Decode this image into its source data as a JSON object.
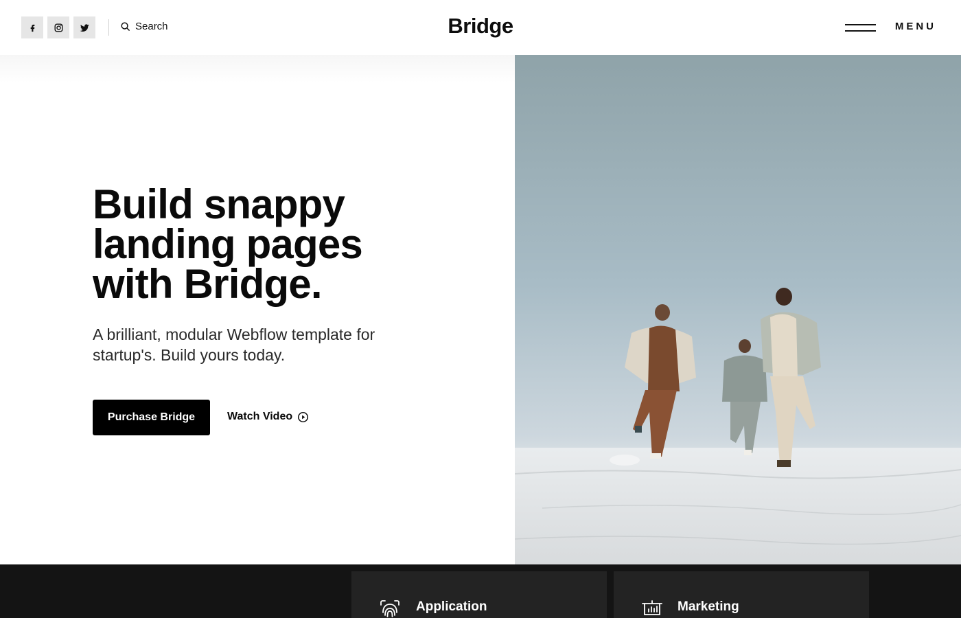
{
  "header": {
    "social": [
      {
        "name": "facebook-icon"
      },
      {
        "name": "instagram-icon"
      },
      {
        "name": "twitter-icon"
      }
    ],
    "search_label": "Search",
    "logo": "Bridge",
    "menu_label": "MENU"
  },
  "hero": {
    "headline": "Build snappy landing pages with Bridge.",
    "subtext": "A brilliant, modular Webflow template for startup's. Build yours today.",
    "primary_button": "Purchase Bridge",
    "video_button": "Watch Video"
  },
  "features": [
    {
      "title": "Application",
      "icon": "fingerprint-icon"
    },
    {
      "title": "Marketing",
      "icon": "presentation-chart-icon"
    }
  ],
  "colors": {
    "accent": "#000000",
    "band_background": "#141414",
    "card_background": "#232323",
    "social_button": "#e6e6e6"
  }
}
